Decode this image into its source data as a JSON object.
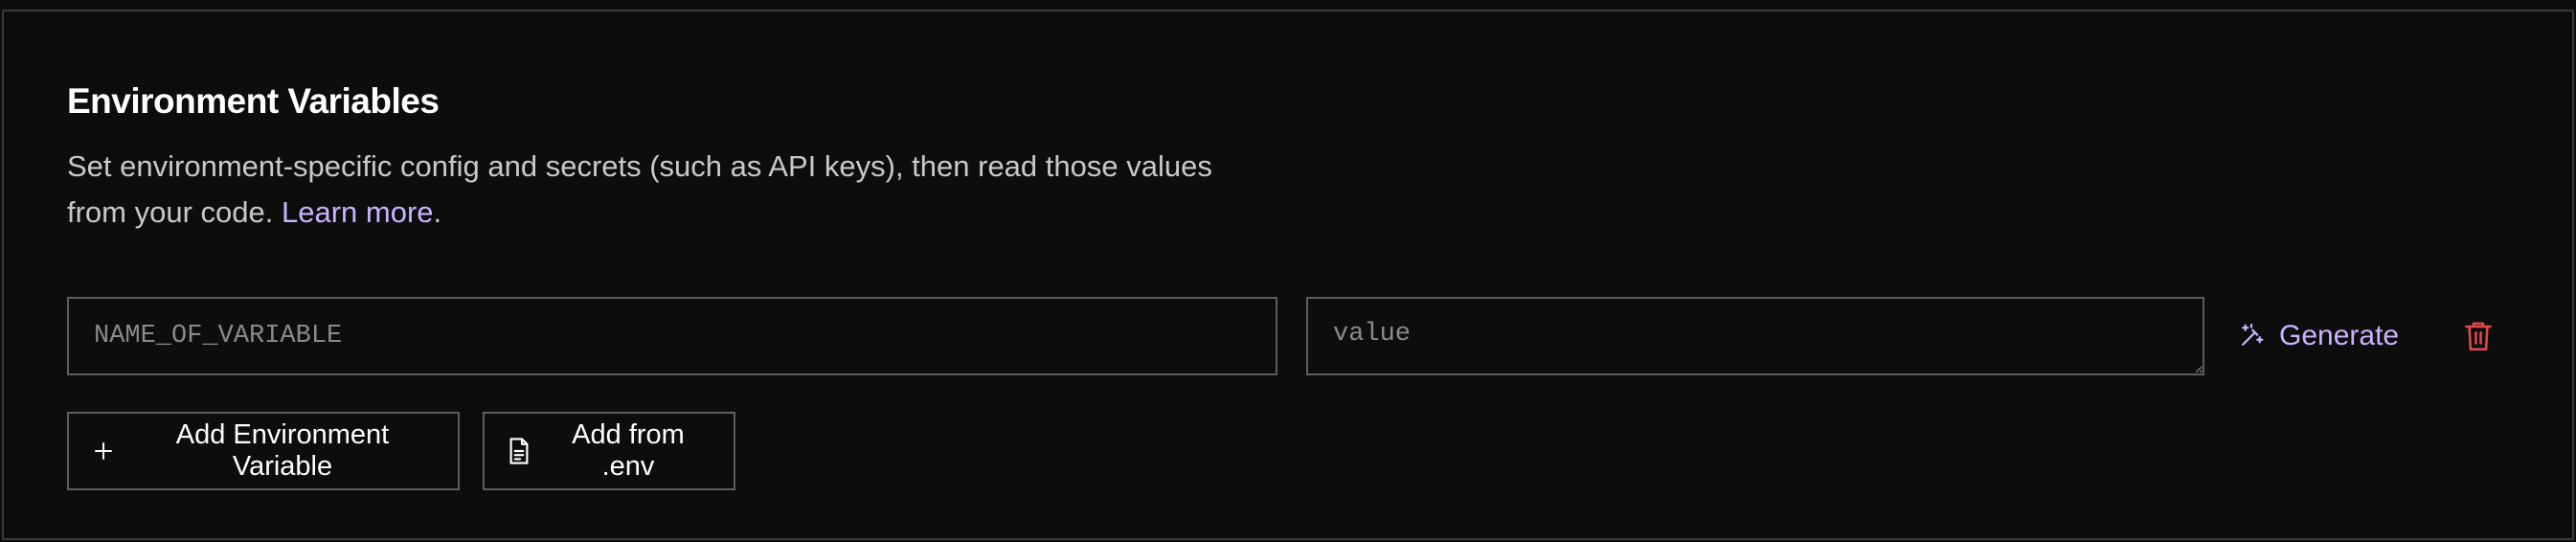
{
  "section": {
    "title": "Environment Variables",
    "description_text": "Set environment-specific config and secrets (such as API keys), then read those values from your code.",
    "learn_more_label": "Learn more"
  },
  "env_row": {
    "name_placeholder": "NAME_OF_VARIABLE",
    "name_value": "",
    "value_placeholder": "value",
    "value_value": "",
    "generate_label": "Generate"
  },
  "actions": {
    "add_variable_label": "Add Environment Variable",
    "add_from_env_label": "Add from .env"
  },
  "icons": {
    "generate": "magic-wand-icon",
    "delete": "trash-icon",
    "add": "plus-icon",
    "file": "file-icon"
  },
  "colors": {
    "background": "#0d0d0d",
    "border": "#5e5e5e",
    "accent": "#c8b3ff",
    "danger": "#e5484d",
    "text": "#ffffff",
    "muted_text": "#c9c9c9"
  }
}
